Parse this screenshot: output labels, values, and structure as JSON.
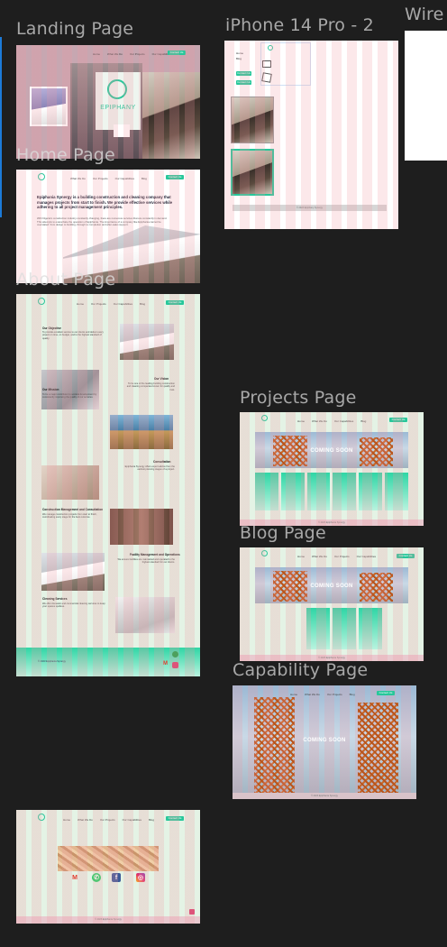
{
  "canvas": {
    "background": "#1e1e1e",
    "grid_color": "#f096a0",
    "accent": "#27c79a"
  },
  "frames": {
    "landing": {
      "label": "Landing Page",
      "brand": "EPIPHANY",
      "nav": [
        "Home",
        "What We Do",
        "Our Projects",
        "Our Capabilities"
      ],
      "cta": "Contact Us"
    },
    "iphone": {
      "label": "iPhone 14 Pro - 2",
      "menu": [
        "Home",
        "Blog"
      ],
      "buttons": [
        "Contact Us",
        "Contact Us"
      ],
      "footer": "© 2023 Epiphany Synergy"
    },
    "wire": {
      "label": "Wire"
    },
    "home": {
      "label": "Home Page",
      "nav": [
        "What We Do",
        "Our Projects",
        "Our Capabilities",
        "Blog"
      ],
      "cta": "Contact Us",
      "headline": "Epiphania Synergy is a building construction and cleaning company that manages projects from start to finish. We provide effective services while adhering to all project management principles.",
      "body": "With Nigeria's construction industry constantly changing, there are numerous services that are constantly in demand. This attempts to exacerbate the operation of Epiphania. The importance of a company like Epiphania cannot be overstated: from design to building, through to completion and after-sales support."
    },
    "about": {
      "label": "About Page",
      "nav": [
        "Home",
        "Our Projects",
        "Our Capabilities",
        "Blog"
      ],
      "cta": "Contact Us",
      "sections": [
        {
          "title": "Our Objective",
          "text": "To provide excellent service to our clients and deliver every project on time, on budget, and to the highest standard of quality."
        },
        {
          "title": "Our Vision",
          "text": "To be one of the leading building construction and cleaning companies known for quality and trust."
        },
        {
          "title": "Our Mission",
          "text": "To be a major contributor to societal development by consistently improving the quality of our services."
        },
        {
          "title": "Consultation",
          "text": "Epiphania Synergy offers expert advice from the earliest planning stages of a project."
        },
        {
          "title": "Construction Management and Consultation",
          "text": "We manage construction projects from start to finish, coordinating every stage for the best outcome."
        },
        {
          "title": "Facility Management and Operations",
          "text": "We ensure facilities are maintained and operated to the highest standard for our clients."
        },
        {
          "title": "Cleaning Services",
          "text": "We offer domestic and commercial cleaning services to keep your spaces spotless."
        }
      ],
      "footer": "© 2023 Epiphania Synergy"
    },
    "projects": {
      "label": "Projects Page",
      "nav": [
        "Home",
        "What We Do",
        "Our Capabilities",
        "Blog"
      ],
      "cta": "Contact Us",
      "banner": "COMING SOON",
      "footer": "© 2023 Epiphania Synergy"
    },
    "blog": {
      "label": "Blog Page",
      "nav": [
        "Home",
        "What We Do",
        "Our Projects",
        "Our Capabilities"
      ],
      "cta": "Contact Us",
      "banner": "COMING SOON",
      "footer": "© 2023 Epiphania Synergy"
    },
    "capability": {
      "label": "Capability Page",
      "nav": [
        "Home",
        "What We Do",
        "Our Projects",
        "Blog"
      ],
      "cta": "Contact Us",
      "banner": "COMING SOON",
      "footer": "© 2023 Epiphania Synergy"
    },
    "contact": {
      "nav": [
        "Home",
        "What We Do",
        "Our Projects",
        "Our Capabilities",
        "Blog"
      ],
      "cta": "Contact Us",
      "icons": [
        "gmail-icon",
        "whatsapp-icon",
        "facebook-icon",
        "instagram-icon"
      ],
      "footer": "© 2023 Epiphania Synergy"
    }
  }
}
